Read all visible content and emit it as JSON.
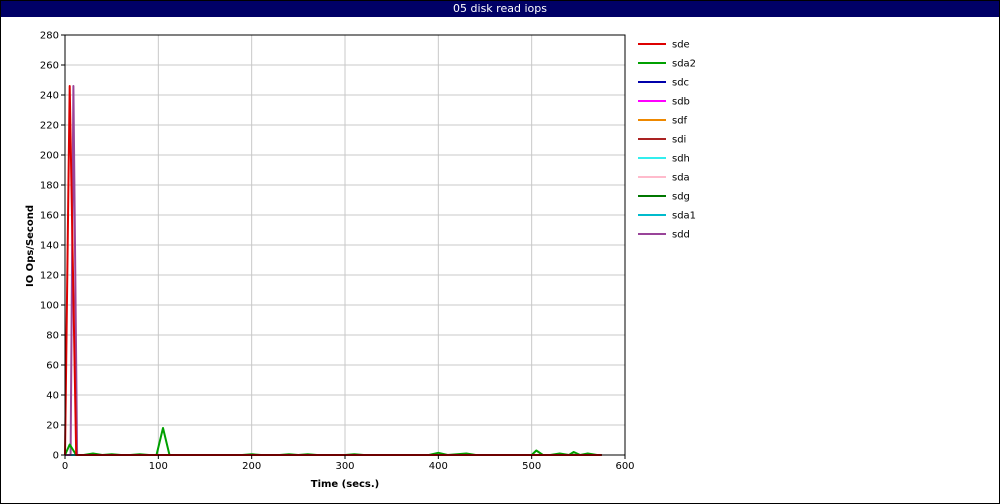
{
  "window": {
    "title": "05 disk read iops"
  },
  "colors": {
    "title_bar": "#000066",
    "grid": "#c8c8c8",
    "axis": "#000000"
  },
  "chart_data": {
    "type": "line",
    "title": "05 disk read iops",
    "xlabel": "Time (secs.)",
    "ylabel": "IO Ops/Second",
    "xlim": [
      0,
      600
    ],
    "ylim": [
      0,
      280
    ],
    "xticks": [
      0,
      100,
      200,
      300,
      400,
      500,
      600
    ],
    "yticks": [
      0,
      20,
      40,
      60,
      80,
      100,
      120,
      140,
      160,
      180,
      200,
      220,
      240,
      260,
      280
    ],
    "grid": true,
    "legend": "right",
    "series": [
      {
        "name": "sde",
        "color": "#dd0000",
        "x": [
          0,
          5,
          12,
          20,
          100,
          200,
          300,
          400,
          500,
          575
        ],
        "y": [
          0,
          246,
          0,
          0,
          0,
          0,
          0,
          0,
          0,
          0
        ]
      },
      {
        "name": "sda2",
        "color": "#00a000",
        "x": [
          0,
          5,
          12,
          20,
          30,
          40,
          50,
          60,
          70,
          80,
          90,
          98,
          105,
          112,
          120,
          130,
          140,
          150,
          160,
          170,
          180,
          190,
          200,
          210,
          220,
          230,
          240,
          250,
          260,
          270,
          280,
          290,
          300,
          310,
          320,
          330,
          340,
          350,
          360,
          370,
          380,
          390,
          400,
          410,
          420,
          430,
          440,
          450,
          460,
          470,
          480,
          490,
          500,
          505,
          512,
          520,
          530,
          540,
          545,
          552,
          560,
          570,
          575
        ],
        "y": [
          0,
          7,
          0,
          0,
          1,
          0,
          0.5,
          0,
          0,
          0.5,
          0,
          0,
          18,
          0,
          0,
          0,
          0,
          0,
          0,
          0,
          0,
          0,
          0.5,
          0,
          0,
          0,
          0.5,
          0,
          0.5,
          0,
          0,
          0,
          0,
          0.5,
          0,
          0,
          0,
          0,
          0,
          0,
          0,
          0,
          1.5,
          0,
          0.5,
          1,
          0,
          0,
          0,
          0,
          0,
          0,
          0,
          3,
          0,
          0,
          1,
          0,
          2,
          0,
          1,
          0,
          0
        ]
      },
      {
        "name": "sdc",
        "color": "#0000aa",
        "x": [
          0,
          100,
          200,
          300,
          400,
          500,
          575
        ],
        "y": [
          0,
          0,
          0,
          0,
          0,
          0,
          0
        ]
      },
      {
        "name": "sdb",
        "color": "#ff00ff",
        "x": [
          0,
          100,
          200,
          300,
          400,
          500,
          575
        ],
        "y": [
          0,
          0,
          0,
          0,
          0,
          0,
          0
        ]
      },
      {
        "name": "sdf",
        "color": "#ee8800",
        "x": [
          0,
          100,
          200,
          300,
          400,
          500,
          575
        ],
        "y": [
          0,
          0,
          0,
          0,
          0,
          0,
          0
        ]
      },
      {
        "name": "sdi",
        "color": "#aa2222",
        "x": [
          0,
          100,
          200,
          300,
          400,
          500,
          575
        ],
        "y": [
          0,
          0,
          0,
          0,
          0,
          0,
          0
        ]
      },
      {
        "name": "sdh",
        "color": "#33eeee",
        "x": [
          0,
          100,
          200,
          300,
          400,
          500,
          575
        ],
        "y": [
          0,
          0,
          0,
          0,
          0,
          0,
          0
        ]
      },
      {
        "name": "sda",
        "color": "#ffbbcc",
        "x": [
          0,
          100,
          200,
          300,
          400,
          500,
          575
        ],
        "y": [
          0,
          0,
          0,
          0,
          0,
          0,
          0
        ]
      },
      {
        "name": "sdg",
        "color": "#007700",
        "x": [
          0,
          100,
          200,
          300,
          400,
          500,
          575
        ],
        "y": [
          0,
          0,
          0,
          0,
          0,
          0,
          0
        ]
      },
      {
        "name": "sda1",
        "color": "#00bbcc",
        "x": [
          0,
          100,
          200,
          300,
          400,
          500,
          575
        ],
        "y": [
          0,
          0,
          0,
          0,
          0,
          0,
          0
        ]
      },
      {
        "name": "sdd",
        "color": "#994499",
        "x": [
          0,
          6,
          9,
          13,
          20,
          100,
          200,
          300,
          400,
          500,
          575
        ],
        "y": [
          0,
          0,
          246,
          0,
          0,
          0,
          0,
          0,
          0,
          0,
          0
        ]
      }
    ]
  }
}
